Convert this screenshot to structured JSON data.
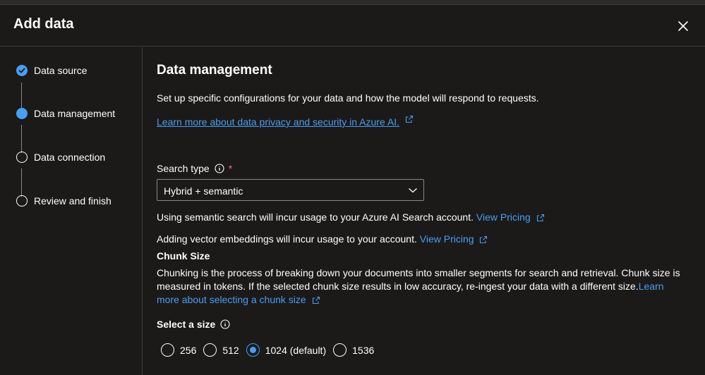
{
  "dialog": {
    "title": "Add data",
    "close_icon": "close-icon"
  },
  "steps": [
    {
      "label": "Data source",
      "state": "completed"
    },
    {
      "label": "Data management",
      "state": "current"
    },
    {
      "label": "Data connection",
      "state": "pending"
    },
    {
      "label": "Review and finish",
      "state": "pending"
    }
  ],
  "main": {
    "heading": "Data management",
    "description": "Set up specific configurations for your data and how the model will respond to requests.",
    "privacy_link": "Learn more about data privacy and security in Azure AI.",
    "search_type_label": "Search type",
    "required_marker": "*",
    "search_type_value": "Hybrid + semantic",
    "semantic_note": "Using semantic search will incur usage to your Azure AI Search account.",
    "semantic_pricing_link": "View Pricing",
    "vector_note": "Adding vector embeddings will incur usage to your account.",
    "vector_pricing_link": "View Pricing",
    "chunk_heading": "Chunk Size",
    "chunk_desc": "Chunking is the process of breaking down your documents into smaller segments for search and retrieval. Chunk size is measured in tokens. If the selected chunk size results in low accuracy, re-ingest your data with a different size.",
    "chunk_link": "Learn more about selecting a chunk size",
    "select_size_label": "Select a size",
    "size_options": [
      "256",
      "512",
      "1024 (default)",
      "1536"
    ],
    "selected_size": "1024 (default)"
  },
  "colors": {
    "accent": "#479ef5",
    "background": "#1b1a19",
    "required": "#f1707b"
  }
}
